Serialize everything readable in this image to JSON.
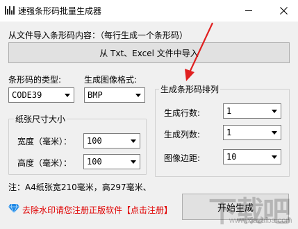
{
  "window": {
    "title": "速强条形码批量生成器"
  },
  "import_section": {
    "label": "从文件导入条形码内容：（每行生成一个条形码）",
    "button_label": "从 Txt、Excel 文件中导入"
  },
  "barcode_type": {
    "label": "条形码的类型:",
    "value": "CODE39"
  },
  "image_format": {
    "label": "生成图像格式:",
    "value": "BMP"
  },
  "paper_size": {
    "title": "纸张尺寸大小",
    "width_label": "宽度（毫米）：",
    "width_value": "100",
    "height_label": "高度（毫米）：",
    "height_value": "100"
  },
  "layout": {
    "title": "生成条形码排列",
    "rows_label": "生成行数:",
    "rows_value": "1",
    "cols_label": "生成列数:",
    "cols_value": "1",
    "margin_label": "图像边距:",
    "margin_value": "10"
  },
  "note": "注：A4纸张宽210毫米，高297毫米、",
  "footer": {
    "remove_watermark_text": "去除水印请您注册正版软件【点击注册】",
    "start_button_label": "开始生成"
  },
  "watermark": {
    "text": "下载吧",
    "domain": "www.xiazaiba.com"
  },
  "colors": {
    "arrow": "#e02020",
    "link_red": "#e00000",
    "accent": "#0078d7"
  },
  "icons": {
    "app": "app-icon",
    "close": "close-icon",
    "minimize": "minimize-icon",
    "diamond": "diamond-icon"
  }
}
